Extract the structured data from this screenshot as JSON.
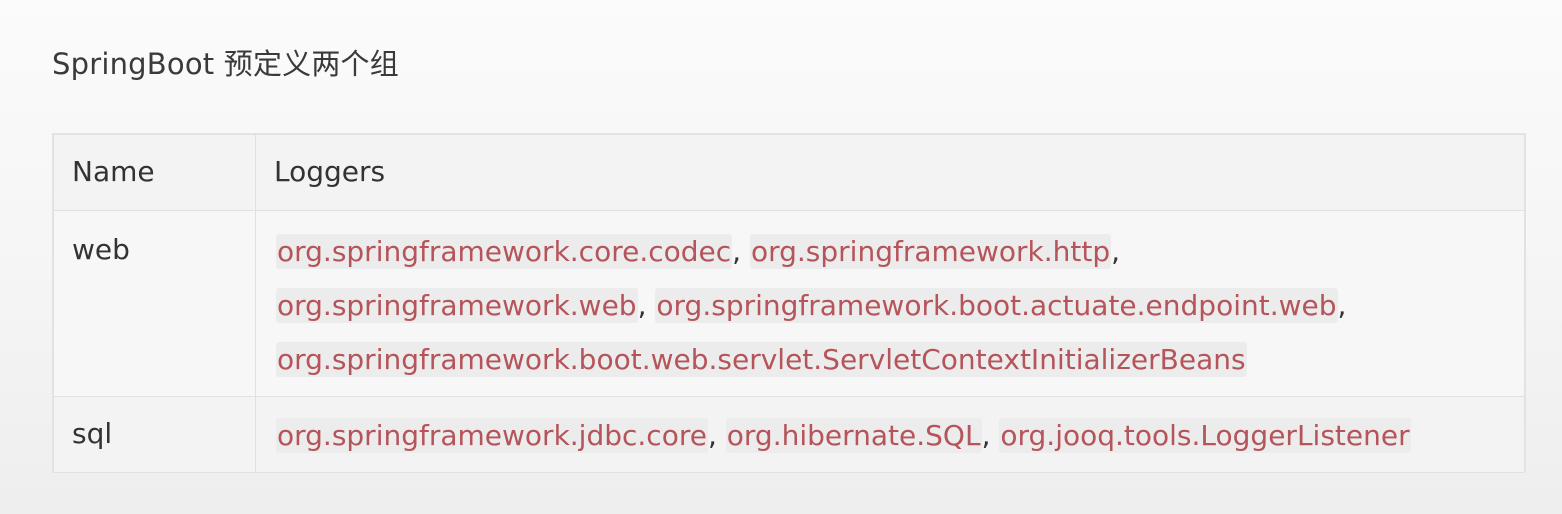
{
  "heading": "SpringBoot 预定义两个组",
  "table": {
    "headers": [
      "Name",
      "Loggers"
    ],
    "rows": [
      {
        "name": "web",
        "loggers": [
          "org.springframework.core.codec",
          "org.springframework.http",
          "org.springframework.web",
          "org.springframework.boot.actuate.endpoint.web",
          "org.springframework.boot.web.servlet.ServletContextInitializerBeans"
        ]
      },
      {
        "name": "sql",
        "loggers": [
          "org.springframework.jdbc.core",
          "org.hibernate.SQL",
          "org.jooq.tools.LoggerListener"
        ]
      }
    ]
  },
  "colors": {
    "code_text": "#b5545a",
    "code_background": "#ececec",
    "body_text": "#333333"
  }
}
